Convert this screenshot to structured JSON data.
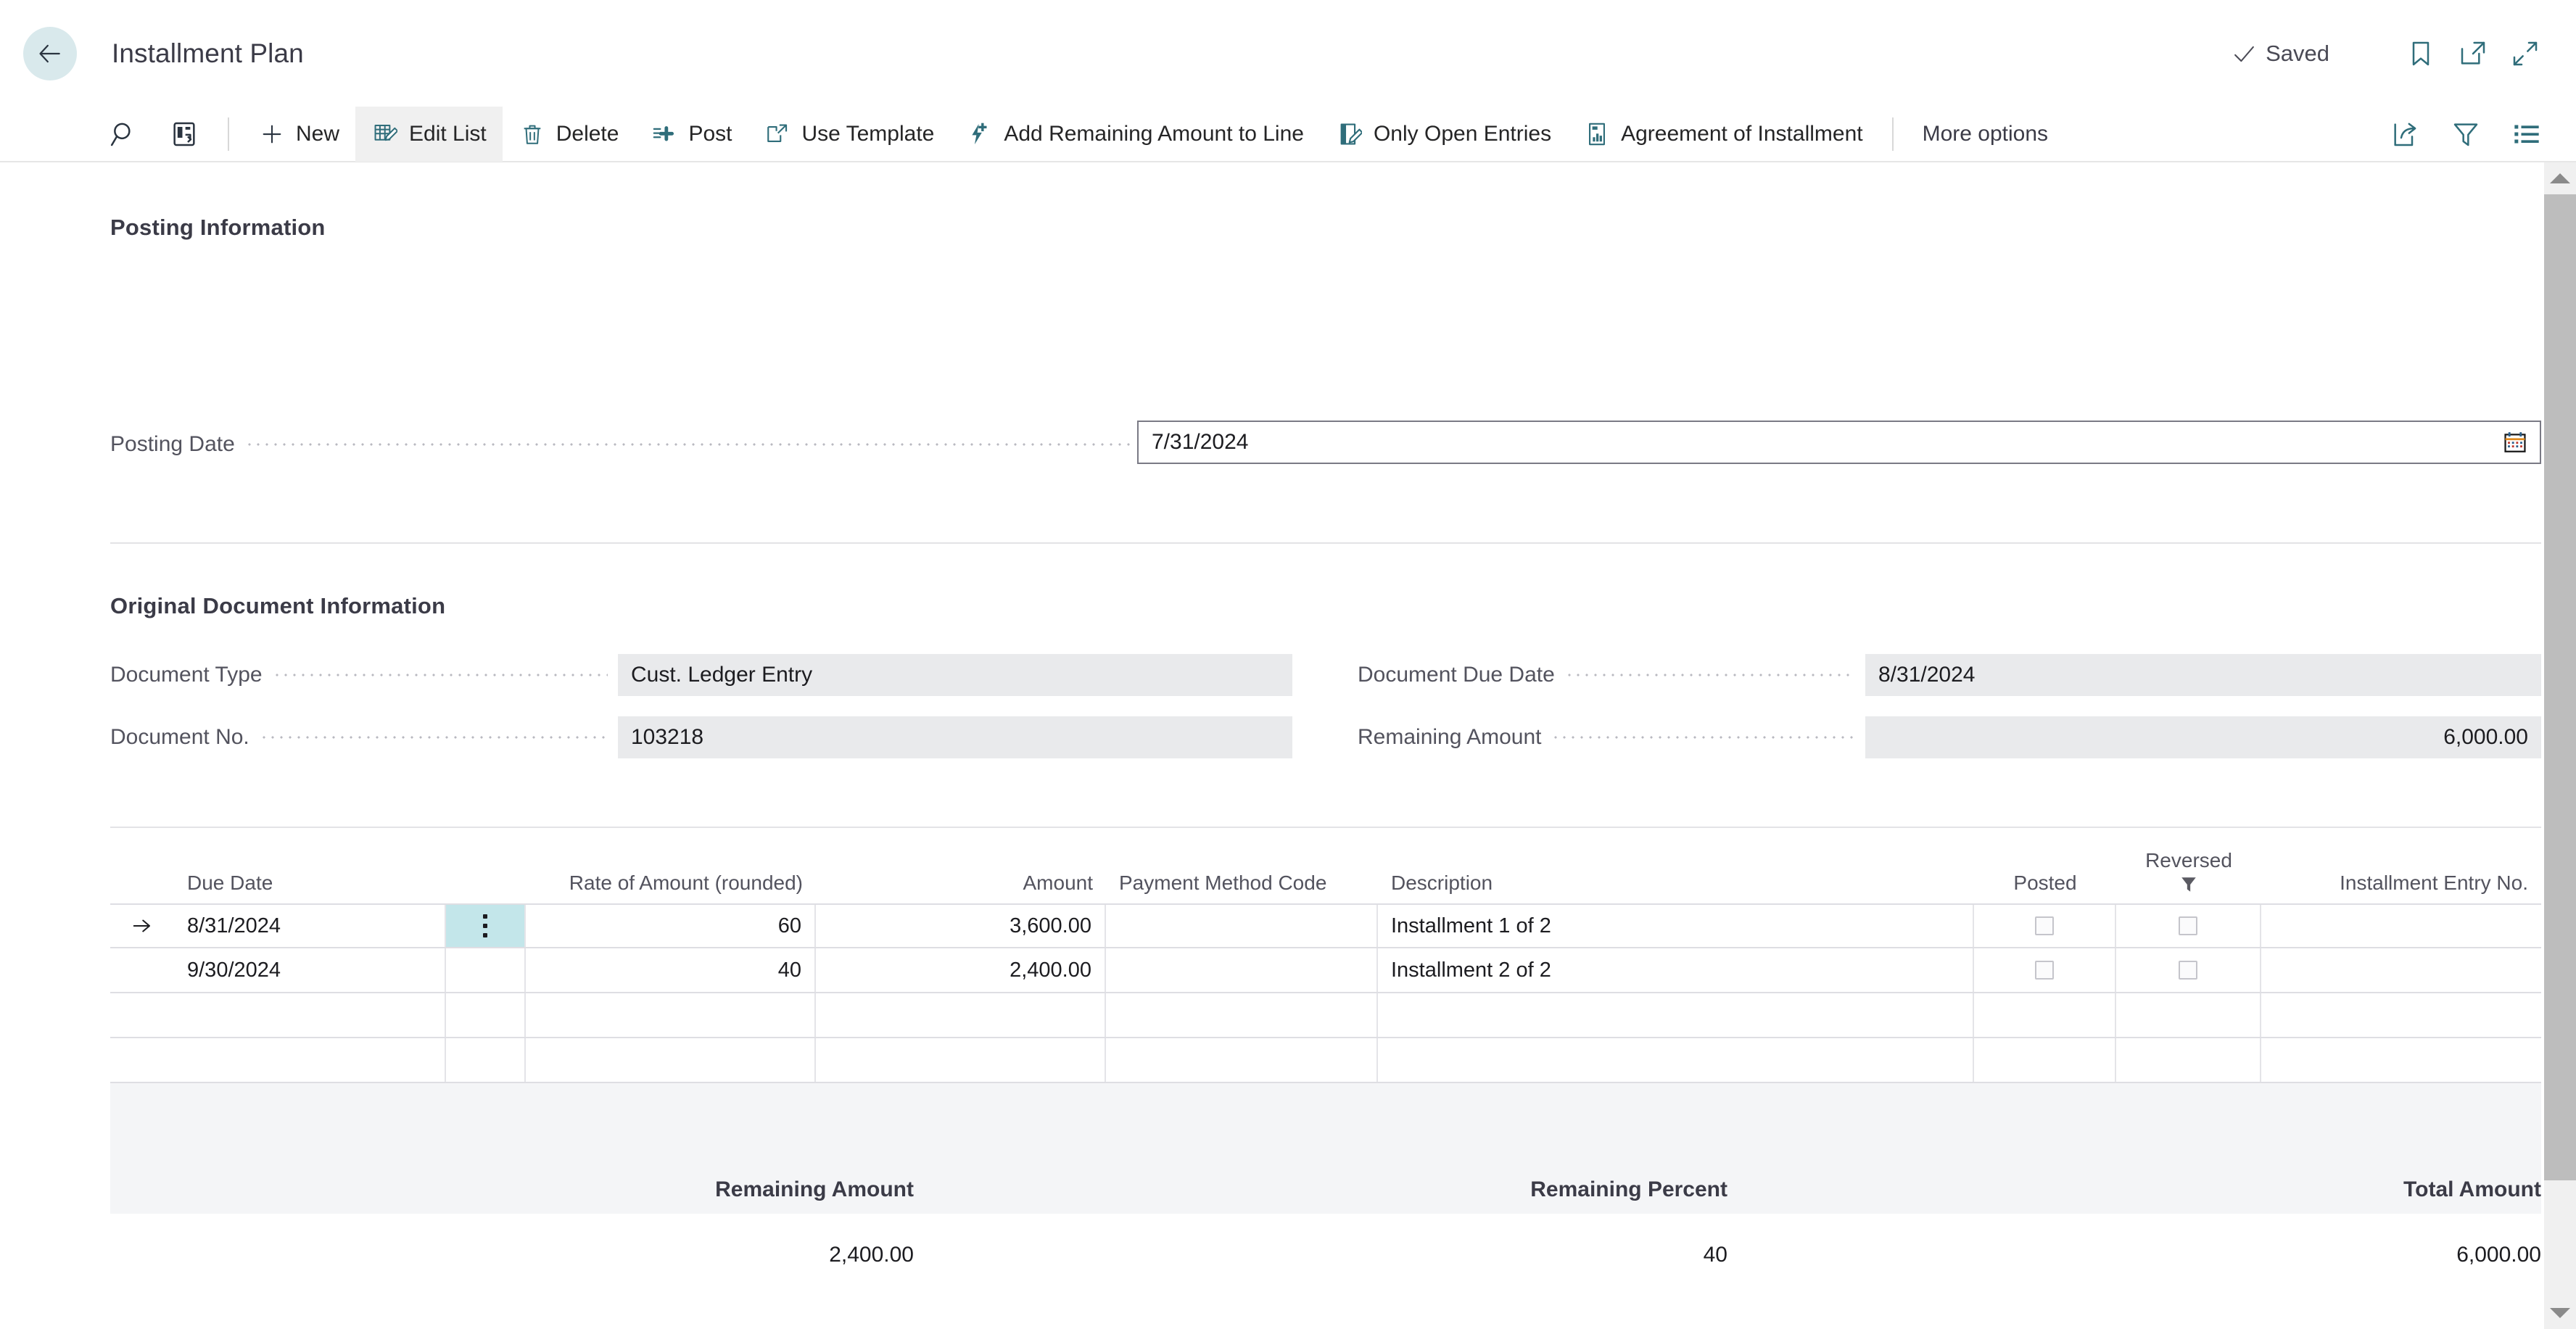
{
  "header": {
    "back_label": "Back",
    "title": "Installment Plan",
    "saved_label": "Saved",
    "bookmark_label": "Bookmark",
    "open_new_label": "Open in new window",
    "collapse_label": "Minimize"
  },
  "toolbar": {
    "search_label": "Search",
    "open_in_excel_label": "Open in Excel",
    "new_label": "New",
    "edit_list_label": "Edit List",
    "delete_label": "Delete",
    "post_label": "Post",
    "use_template_label": "Use Template",
    "add_remaining_label": "Add Remaining Amount to Line",
    "only_open_entries_label": "Only Open Entries",
    "agreement_label": "Agreement of Installment",
    "more_options_label": "More options",
    "share_label": "Share",
    "filter_label": "Filter",
    "list_label": "Show list"
  },
  "posting_information": {
    "section_title": "Posting Information",
    "posting_date_label": "Posting Date",
    "posting_date_value": "7/31/2024"
  },
  "original_document": {
    "section_title": "Original Document Information",
    "document_type_label": "Document Type",
    "document_type_value": "Cust. Ledger Entry",
    "document_no_label": "Document No.",
    "document_no_value": "103218",
    "document_due_date_label": "Document Due Date",
    "document_due_date_value": "8/31/2024",
    "remaining_amount_label": "Remaining Amount",
    "remaining_amount_value": "6,000.00"
  },
  "grid": {
    "columns": [
      {
        "key": "due_date",
        "label": "Due Date"
      },
      {
        "key": "rate",
        "label": "Rate of Amount (rounded)"
      },
      {
        "key": "amount",
        "label": "Amount"
      },
      {
        "key": "pay_method",
        "label": "Payment Method Code"
      },
      {
        "key": "desc",
        "label": "Description"
      },
      {
        "key": "posted",
        "label": "Posted"
      },
      {
        "key": "reversed",
        "label": "Reversed"
      },
      {
        "key": "entry_no",
        "label": "Installment Entry No."
      }
    ],
    "rows": [
      {
        "due_date": "8/31/2024",
        "rate": "60",
        "amount": "3,600.00",
        "pay_method": "",
        "desc": "Installment 1 of 2",
        "posted": false,
        "reversed": false,
        "entry_no": ""
      },
      {
        "due_date": "9/30/2024",
        "rate": "40",
        "amount": "2,400.00",
        "pay_method": "",
        "desc": "Installment 2 of 2",
        "posted": false,
        "reversed": false,
        "entry_no": ""
      }
    ],
    "selected_row_index": 0
  },
  "totals": {
    "remaining_amount_label": "Remaining Amount",
    "remaining_amount_value": "2,400.00",
    "remaining_percent_label": "Remaining Percent",
    "remaining_percent_value": "40",
    "total_amount_label": "Total Amount",
    "total_amount_value": "6,000.00"
  },
  "colors": {
    "accent_teal": "#2f6d7a",
    "selected_cell": "#c3e6ea",
    "back_circle": "#d9e9ec",
    "readonly_field": "#e9eaec",
    "grid_fill": "#f4f5f7"
  }
}
